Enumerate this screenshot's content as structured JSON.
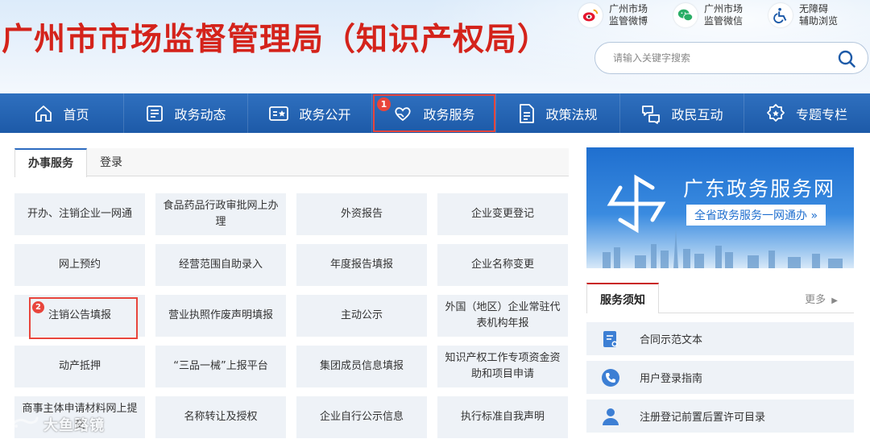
{
  "header": {
    "site_title": "广州市市场监督管理局（知识产权局）",
    "top_links": [
      {
        "icon": "weibo-icon",
        "label": "广州市场\n监管微博"
      },
      {
        "icon": "wechat-icon",
        "label": "广州市场\n监管微信"
      },
      {
        "icon": "accessibility-icon",
        "label": "无障碍\n辅助浏览"
      }
    ],
    "search_placeholder": "请输入关键字搜索"
  },
  "nav": {
    "items": [
      {
        "label": "首页",
        "icon": "home-icon"
      },
      {
        "label": "政务动态",
        "icon": "news-icon"
      },
      {
        "label": "政务公开",
        "icon": "open-info-icon"
      },
      {
        "label": "政务服务",
        "icon": "heart-service-icon",
        "badge": "1",
        "active": true
      },
      {
        "label": "政策法规",
        "icon": "document-icon"
      },
      {
        "label": "政民互动",
        "icon": "interaction-icon"
      },
      {
        "label": "专题专栏",
        "icon": "gear-badge-icon"
      }
    ]
  },
  "left": {
    "tabs": [
      "办事服务",
      "登录"
    ],
    "services": [
      "开办、注销企业一网通",
      "食品药品行政审批网上办理",
      "外资报告",
      "企业变更登记",
      "网上预约",
      "经营范围自助录入",
      "年度报告填报",
      "企业名称变更",
      "注销公告填报",
      "营业执照作废声明填报",
      "主动公示",
      "外国（地区）企业常驻代表机构年报",
      "动产抵押",
      "“三品一械”上报平台",
      "集团成员信息填报",
      "知识产权工作专项资金资助和项目申请",
      "商事主体申请材料网上提交",
      "名称转让及授权",
      "企业自行公示信息",
      "执行标准自我声明"
    ],
    "highlight_badge": "2"
  },
  "right": {
    "banner_title": "广东政务服务网",
    "banner_subtitle": "全省政务服务一网通办 »",
    "notice_title": "服务须知",
    "notice_more": "更多",
    "notices": [
      {
        "icon": "contract-icon",
        "label": "合同示范文本"
      },
      {
        "icon": "phone-icon",
        "label": "用户登录指南"
      },
      {
        "icon": "user-icon",
        "label": "注册登记前置后置许可目录"
      }
    ]
  },
  "watermark": "大鱼路镜",
  "colors": {
    "title_red": "#d4231b",
    "nav_blue": "#2f70bf",
    "highlight_red": "#e8453c",
    "cell_bg": "#eef2f7"
  }
}
